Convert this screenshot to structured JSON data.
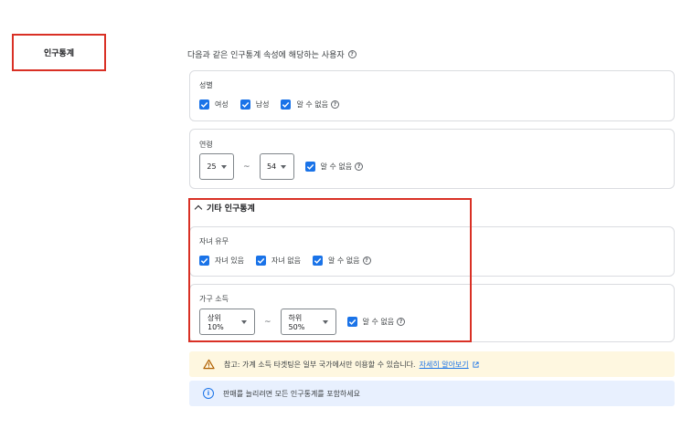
{
  "section_label": "인구통계",
  "heading": "다음과 같은 인구통계 속성에 해당하는 사용자",
  "gender": {
    "title": "성별",
    "options": [
      {
        "label": "여성",
        "checked": true
      },
      {
        "label": "남성",
        "checked": true
      },
      {
        "label": "알 수 없음",
        "checked": true
      }
    ]
  },
  "age": {
    "title": "연령",
    "from": "25",
    "separator": "~",
    "to": "54",
    "unknown_label": "알 수 없음"
  },
  "other": {
    "toggle_label": "기타 인구통계"
  },
  "children": {
    "title": "자녀 유무",
    "options": [
      {
        "label": "자녀 있음",
        "checked": true
      },
      {
        "label": "자녀 없음",
        "checked": true
      },
      {
        "label": "알 수 없음",
        "checked": true
      }
    ]
  },
  "income": {
    "title": "가구 소득",
    "from": "상위 10%",
    "separator": "~",
    "to": "하위 50%",
    "unknown_label": "알 수 없음"
  },
  "notices": {
    "warning_text": "참고: 가계 소득 타겟팅은 일부 국가에서만 이용할 수 있습니다.",
    "warning_link": "자세히 알아보기",
    "info_text": "판매를 늘리려면 모든 인구통계를 포함하세요"
  },
  "colors": {
    "accent": "#1a73e8",
    "highlight": "#d93025",
    "warning_bg": "#fef7e0",
    "info_bg": "#e8f0fe"
  }
}
